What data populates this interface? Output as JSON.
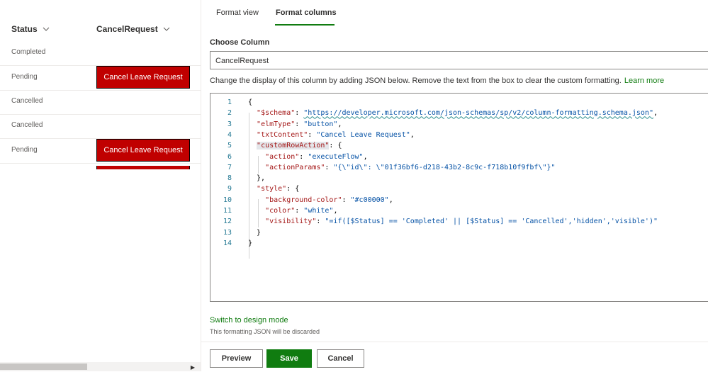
{
  "list": {
    "headers": {
      "status": "Status",
      "cancel_request": "CancelRequest"
    },
    "rows": [
      {
        "status": "Completed",
        "button": ""
      },
      {
        "status": "Pending",
        "button": "Cancel Leave Request"
      },
      {
        "status": "Cancelled",
        "button": ""
      },
      {
        "status": "Cancelled",
        "button": ""
      },
      {
        "status": "Pending",
        "button": "Cancel Leave Request"
      }
    ]
  },
  "panel": {
    "tabs": [
      "Format view",
      "Format columns"
    ],
    "active_tab": "Format columns",
    "choose_label": "Choose Column",
    "column_value": "CancelRequest",
    "help_text": "Change the display of this column by adding JSON below. Remove the text from the box to clear the custom formatting.",
    "learn_more": "Learn more",
    "switch_link": "Switch to design mode",
    "discard_note": "This formatting JSON will be discarded",
    "buttons": {
      "preview": "Preview",
      "save": "Save",
      "cancel": "Cancel"
    }
  },
  "editor": {
    "line_numbers": [
      "1",
      "2",
      "3",
      "4",
      "5",
      "6",
      "7",
      "8",
      "9",
      "10",
      "11",
      "12",
      "13",
      "14"
    ],
    "lines": [
      "{",
      "  \"$schema\": \"https://developer.microsoft.com/json-schemas/sp/v2/column-formatting.schema.json\",",
      "  \"elmType\": \"button\",",
      "  \"txtContent\": \"Cancel Leave Request\",",
      "  \"customRowAction\": {",
      "    \"action\": \"executeFlow\",",
      "    \"actionParams\": \"{\\\"id\\\": \\\"01f36bf6-d218-43b2-8c9c-f718b10f9fbf\\\"}\"",
      "  },",
      "  \"style\": {",
      "    \"background-color\": \"#c00000\",",
      "    \"color\": \"white\",",
      "    \"visibility\": \"=if([$Status] == 'Completed' || [$Status] == 'Cancelled','hidden','visible')\"",
      "  }",
      "}"
    ]
  },
  "colors": {
    "accent": "#107c10",
    "button_red": "#c00000"
  },
  "icons": [
    "chevron-down-icon",
    "chevron-down-icon",
    "scroll-right-arrow-icon"
  ]
}
